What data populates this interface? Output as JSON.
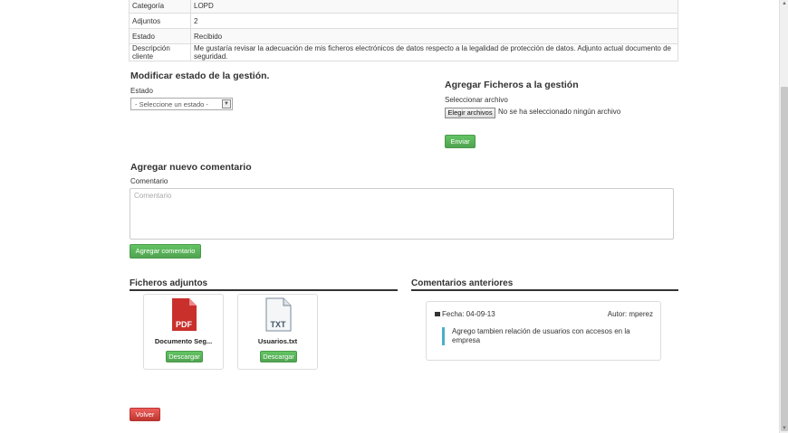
{
  "info_rows": [
    {
      "key": "Categoría",
      "value": "LOPD"
    },
    {
      "key": "Adjuntos",
      "value": "2"
    },
    {
      "key": "Estado",
      "value": "Recibido"
    },
    {
      "key": "Descripción cliente",
      "value": "Me gustaría revisar la adecuación de mis ficheros electrónicos de datos respecto a la legalidad de protección de datos. Adjunto actual documento de seguridad."
    }
  ],
  "estado_form": {
    "title": "Modificar estado de la gestión.",
    "label": "Estado",
    "select_value": "- Seleccione un estado -"
  },
  "ficheros_form": {
    "title": "Agregar Ficheros a la gestión",
    "label": "Seleccionar archivo",
    "file_button": "Elegir archivos",
    "file_status": "No se ha seleccionado ningún archivo",
    "submit": "Enviar"
  },
  "comment_form": {
    "title": "Agregar nuevo comentario",
    "label": "Comentario",
    "placeholder": "Comentario",
    "submit": "Agregar comentario"
  },
  "attachments": {
    "title": "Ficheros adjuntos",
    "files": [
      {
        "name": "Documento Seg...",
        "type_label": "PDF",
        "download": "Descargar"
      },
      {
        "name": "Usuarios.txt",
        "type_label": "TXT",
        "download": "Descargar"
      }
    ]
  },
  "previous_comments": {
    "title": "Comentarios anteriores",
    "items": [
      {
        "fecha": "Fecha: 04-09-13",
        "autor": "Autor: mperez",
        "text": "Agrego tambien relación de usuarios con accesos en la empresa"
      }
    ]
  },
  "back_button": "Volver",
  "colors": {
    "green": "#51a351",
    "red": "#bd362f",
    "accent_blue": "#49afcd",
    "pdf_red": "#c9302c"
  }
}
